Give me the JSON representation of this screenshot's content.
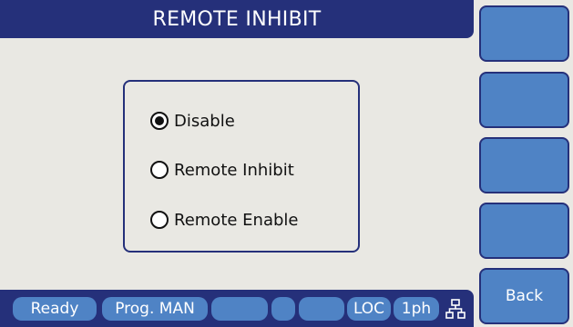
{
  "header": {
    "title": "REMOTE INHIBIT"
  },
  "options": [
    {
      "label": "Disable",
      "selected": true
    },
    {
      "label": "Remote Inhibit",
      "selected": false
    },
    {
      "label": "Remote Enable",
      "selected": false
    }
  ],
  "status": {
    "ready": "Ready",
    "prog": "Prog. MAN",
    "blank1": "",
    "blank2": "",
    "blank3": "",
    "loc": "LOC",
    "phase": "1ph",
    "network_icon": "network-icon"
  },
  "softkeys": [
    "",
    "",
    "",
    "",
    "Back"
  ],
  "colors": {
    "title_bar": "#25307a",
    "chip": "#4f83c5",
    "background": "#e9e8e3"
  }
}
